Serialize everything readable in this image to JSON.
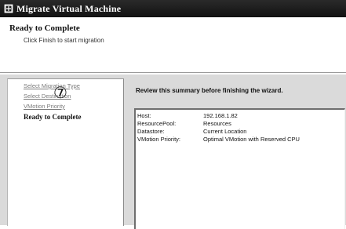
{
  "window": {
    "title": "Migrate Virtual Machine"
  },
  "header": {
    "title": "Ready to Complete",
    "subtitle": "Click Finish to start migration"
  },
  "nav": {
    "items": [
      {
        "label": "Select Migration Type"
      },
      {
        "label": "Select Destination"
      },
      {
        "label": "VMotion Priority"
      },
      {
        "label": "Ready to Complete"
      }
    ],
    "step_marker": "⑦"
  },
  "summary": {
    "heading": "Review this summary before finishing the wizard.",
    "rows": [
      {
        "key": "Host:",
        "value": "192.168.1.82"
      },
      {
        "key": "ResourcePool:",
        "value": "Resources"
      },
      {
        "key": "Datastore:",
        "value": "Current Location"
      },
      {
        "key": "VMotion Priority:",
        "value": "Optimal VMotion with Reserved CPU"
      }
    ]
  },
  "icons": {
    "window_icon": "vm-icon"
  }
}
